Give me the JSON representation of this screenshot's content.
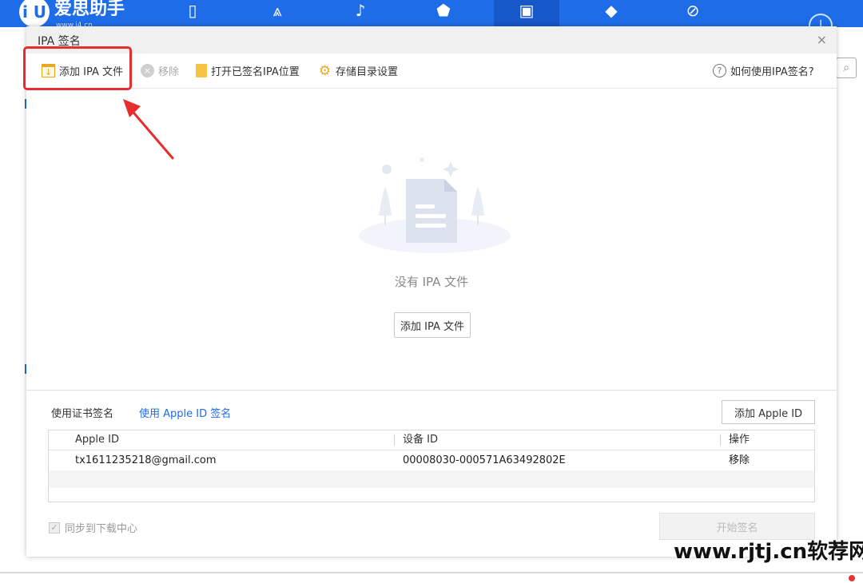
{
  "app": {
    "logo_text": "爱思助手",
    "logo_badge": "i U",
    "logo_sub": "www.i4.cn",
    "nav_icons": [
      "phone-icon",
      "app-store-icon",
      "music-icon",
      "ringtone-icon",
      "toolbox-icon",
      "tutorial-icon",
      "compass-icon"
    ]
  },
  "dialog": {
    "title": "IPA 签名",
    "close": "×",
    "toolbar": {
      "add_ipa": "添加 IPA 文件",
      "remove": "移除",
      "open_signed": "打开已签名IPA位置",
      "storage_settings": "存储目录设置",
      "help": "如何使用IPA签名?"
    },
    "empty": {
      "message": "没有 IPA 文件",
      "add_button": "添加 IPA 文件"
    },
    "sign_tabs": {
      "certificate": "使用证书签名",
      "apple_id": "使用 Apple ID 签名"
    },
    "add_apple_id": "添加 Apple ID",
    "table": {
      "headers": {
        "apple_id": "Apple ID",
        "device_id": "设备 ID",
        "action": "操作"
      },
      "rows": [
        {
          "apple_id": "tx1611235218@gmail.com",
          "device_id": "00008030-000571A63492802E",
          "action": "移除"
        }
      ]
    },
    "sync_label": "同步到下载中心",
    "start_button": "开始签名"
  },
  "watermark": "www.rjtj.cn软荐网",
  "colors": {
    "header": "#1e6ce8",
    "highlight": "#e62e2e",
    "link": "#1e6ce8"
  }
}
